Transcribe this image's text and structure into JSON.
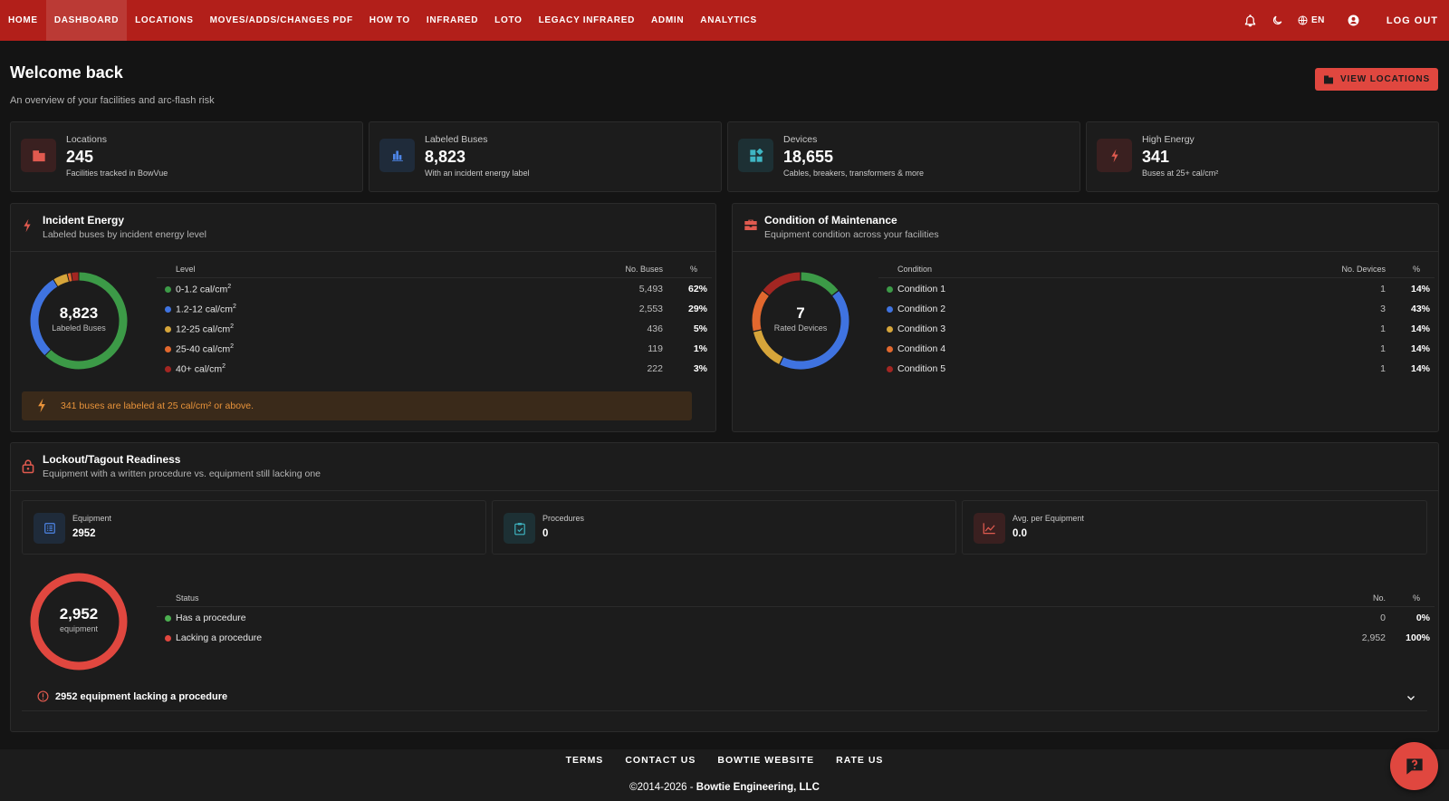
{
  "nav": {
    "items": [
      {
        "label": "HOME"
      },
      {
        "label": "DASHBOARD"
      },
      {
        "label": "LOCATIONS"
      },
      {
        "label": "MOVES/ADDS/CHANGES PDF"
      },
      {
        "label": "HOW TO"
      },
      {
        "label": "INFRARED"
      },
      {
        "label": "LOTO"
      },
      {
        "label": "LEGACY INFRARED"
      },
      {
        "label": "ADMIN"
      },
      {
        "label": "ANALYTICS"
      }
    ],
    "active": "DASHBOARD",
    "language": "EN",
    "logout_label": "LOG OUT"
  },
  "header": {
    "title": "Welcome back",
    "subtitle": "An overview of your facilities and arc-flash risk",
    "view_locations_label": "VIEW LOCATIONS"
  },
  "stats": [
    {
      "label": "Locations",
      "value": "245",
      "note": "Facilities tracked in BowVue",
      "icon": "building-icon"
    },
    {
      "label": "Labeled Buses",
      "value": "8,823",
      "note": "With an incident energy label",
      "icon": "bar-chart-icon"
    },
    {
      "label": "Devices",
      "value": "18,655",
      "note": "Cables, breakers, transformers & more",
      "icon": "widgets-icon"
    },
    {
      "label": "High Energy",
      "value": "341",
      "note": "Buses at 25+ cal/cm²",
      "icon": "lightning-icon"
    }
  ],
  "incident_energy": {
    "title": "Incident Energy",
    "subtitle": "Labeled buses by incident energy level",
    "total": "8,823",
    "total_label": "Labeled Buses",
    "columns": {
      "level": "Level",
      "count": "No. Buses",
      "pct": "%"
    },
    "rows": [
      {
        "label": "0-1.2 cal/cm",
        "count": "5,493",
        "pct": "62%",
        "color": "#3c9a47"
      },
      {
        "label": "1.2-12 cal/cm",
        "count": "2,553",
        "pct": "29%",
        "color": "#3f73e0"
      },
      {
        "label": "12-25 cal/cm",
        "count": "436",
        "pct": "5%",
        "color": "#d6a53a"
      },
      {
        "label": "25-40 cal/cm",
        "count": "119",
        "pct": "1%",
        "color": "#e2682e"
      },
      {
        "label": "40+ cal/cm",
        "count": "222",
        "pct": "3%",
        "color": "#a32622"
      }
    ],
    "unit_superscript": "2",
    "warning": "341 buses are labeled at 25 cal/cm² or above."
  },
  "maintenance": {
    "title": "Condition of Maintenance",
    "subtitle": "Equipment condition across your facilities",
    "total": "7",
    "total_label": "Rated Devices",
    "columns": {
      "level": "Condition",
      "count": "No. Devices",
      "pct": "%"
    },
    "rows": [
      {
        "label": "Condition 1",
        "count": "1",
        "pct": "14%",
        "color": "#3c9a47"
      },
      {
        "label": "Condition 2",
        "count": "3",
        "pct": "43%",
        "color": "#3f73e0"
      },
      {
        "label": "Condition 3",
        "count": "1",
        "pct": "14%",
        "color": "#d6a53a"
      },
      {
        "label": "Condition 4",
        "count": "1",
        "pct": "14%",
        "color": "#e2682e"
      },
      {
        "label": "Condition 5",
        "count": "1",
        "pct": "14%",
        "color": "#a32622"
      }
    ]
  },
  "loto": {
    "title": "Lockout/Tagout Readiness",
    "subtitle": "Equipment with a written procedure vs. equipment still lacking one",
    "minis": [
      {
        "label": "Equipment",
        "value": "2952",
        "icon": "list-icon"
      },
      {
        "label": "Procedures",
        "value": "0",
        "icon": "clipboard-check-icon"
      },
      {
        "label": "Avg. per Equipment",
        "value": "0.0",
        "icon": "trend-icon"
      }
    ],
    "total": "2,952",
    "total_label": "equipment",
    "columns": {
      "level": "Status",
      "count": "No.",
      "pct": "%"
    },
    "rows": [
      {
        "label": "Has a procedure",
        "count": "0",
        "pct": "0%",
        "color": "#4caf50"
      },
      {
        "label": "Lacking a procedure",
        "count": "2,952",
        "pct": "100%",
        "color": "#e0473f"
      }
    ],
    "collapse_label": "2952 equipment lacking a procedure"
  },
  "footer": {
    "links": [
      "TERMS",
      "CONTACT US",
      "BOWTIE WEBSITE",
      "RATE US"
    ],
    "copyright_prefix": "©2014-2026 - ",
    "copyright_company": "Bowtie Engineering, LLC"
  },
  "colors": {
    "brand": "#b21f1a",
    "accent": "#e0473f",
    "warning": "#e8933a"
  },
  "chart_data": [
    {
      "type": "pie",
      "categories": [
        "0-1.2 cal/cm2",
        "1.2-12 cal/cm2",
        "12-25 cal/cm2",
        "25-40 cal/cm2",
        "40+ cal/cm2"
      ],
      "values": [
        5493,
        2553,
        436,
        119,
        222
      ],
      "title": "Incident Energy"
    },
    {
      "type": "pie",
      "categories": [
        "Condition 1",
        "Condition 2",
        "Condition 3",
        "Condition 4",
        "Condition 5"
      ],
      "values": [
        1,
        3,
        1,
        1,
        1
      ],
      "title": "Condition of Maintenance"
    },
    {
      "type": "pie",
      "categories": [
        "Has a procedure",
        "Lacking a procedure"
      ],
      "values": [
        0,
        2952
      ],
      "title": "Lockout/Tagout Readiness"
    }
  ]
}
